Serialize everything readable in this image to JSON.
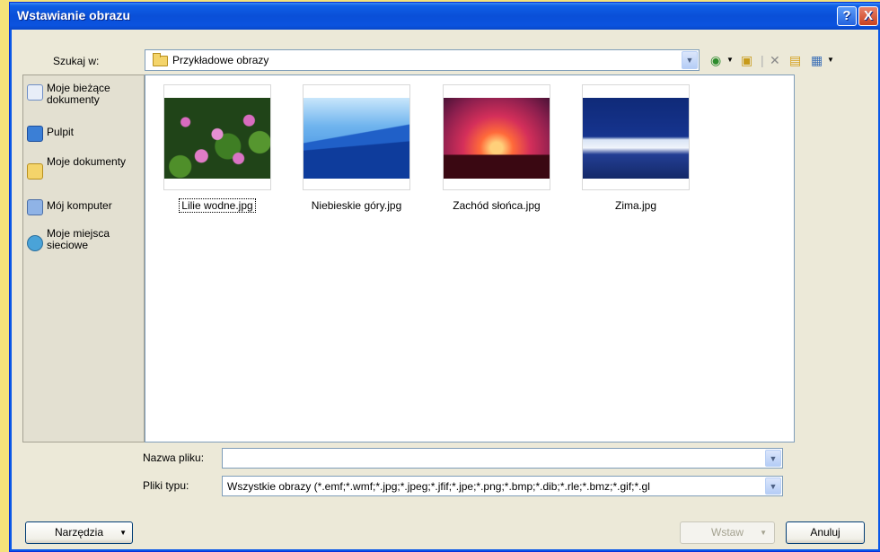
{
  "title": "Wstawianie obrazu",
  "title_buttons": {
    "help": "?",
    "close": "X"
  },
  "look_in": {
    "label": "Szukaj w:",
    "value": "Przykładowe obrazy"
  },
  "places": [
    {
      "label": "Moje bieżące dokumenty",
      "icon": "recent-documents-icon"
    },
    {
      "label": "Pulpit",
      "icon": "desktop-icon"
    },
    {
      "label": "Moje dokumenty",
      "icon": "my-documents-icon"
    },
    {
      "label": "Mój komputer",
      "icon": "my-computer-icon"
    },
    {
      "label": "Moje miejsca sieciowe",
      "icon": "network-places-icon"
    }
  ],
  "files": [
    {
      "name": "Lilie wodne.jpg",
      "selected": true
    },
    {
      "name": "Niebieskie góry.jpg",
      "selected": false
    },
    {
      "name": "Zachód słońca.jpg",
      "selected": false
    },
    {
      "name": "Zima.jpg",
      "selected": false
    }
  ],
  "file_name": {
    "label": "Nazwa pliku:",
    "value": ""
  },
  "file_type": {
    "label": "Pliki typu:",
    "value": "Wszystkie obrazy (*.emf;*.wmf;*.jpg;*.jpeg;*.jfif;*.jpe;*.png;*.bmp;*.dib;*.rle;*.bmz;*.gif;*.gl"
  },
  "buttons": {
    "tools": "Narzędzia",
    "insert": "Wstaw",
    "cancel": "Anuluj"
  },
  "colors": {
    "titlebar": "#0a4fd8",
    "window": "#ece9d8",
    "background": "#f5e27a"
  }
}
